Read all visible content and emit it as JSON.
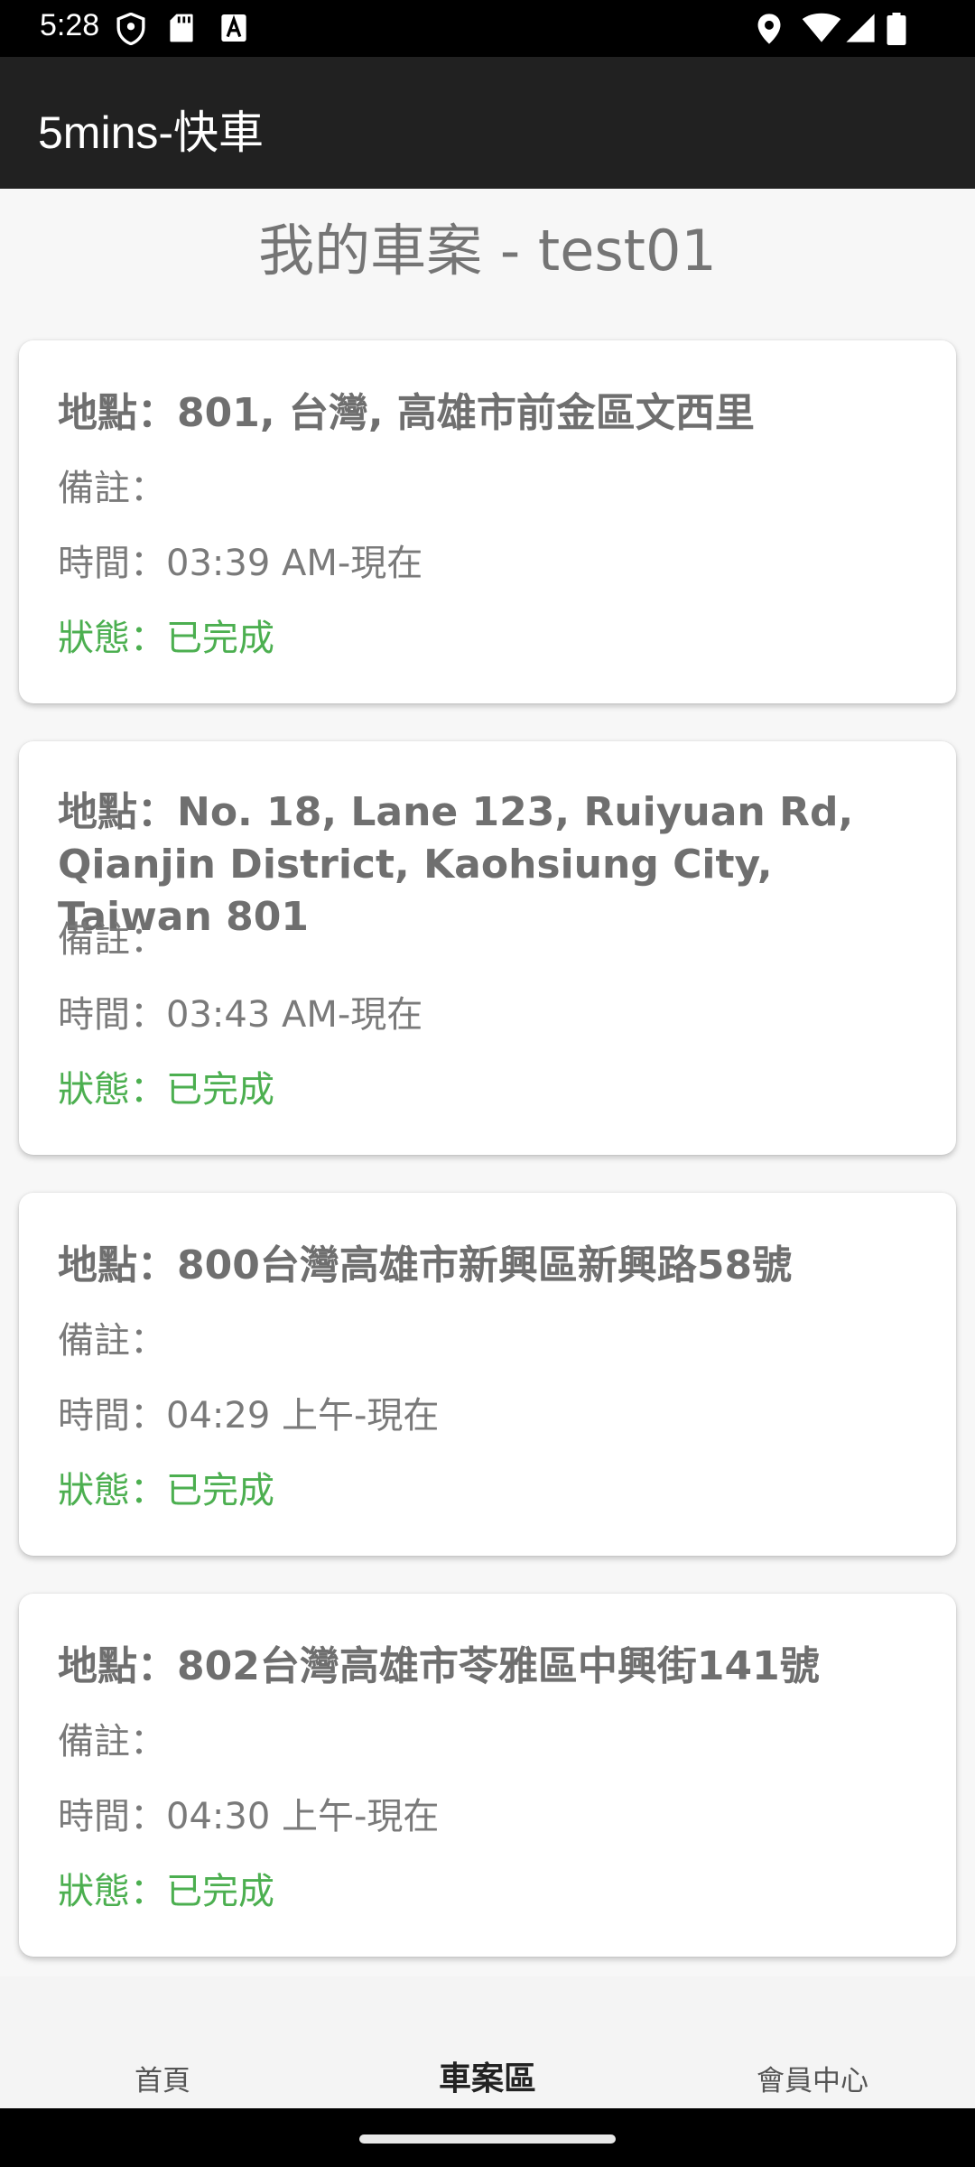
{
  "status_bar": {
    "time": "5:28",
    "icons": [
      "shield-icon",
      "sd-card-icon",
      "font-a-icon",
      "location-icon",
      "wifi-icon",
      "signal-icon",
      "battery-icon"
    ]
  },
  "app_bar": {
    "title": "5mins-快車"
  },
  "page": {
    "title": "我的車案 - test01"
  },
  "cases": [
    {
      "location": "地點：801, 台灣, 高雄市前金區文西里",
      "note": "備註：",
      "time": "時間：03:39 AM-現在",
      "status": "狀態：已完成"
    },
    {
      "location": "地點：No. 18, Lane 123, Ruiyuan Rd, Qianjin District, Kaohsiung City, Taiwan 801",
      "note": "備註：",
      "time": "時間：03:43 AM-現在",
      "status": "狀態：已完成"
    },
    {
      "location": "地點：800台灣高雄市新興區新興路58號",
      "note": "備註：",
      "time": "時間：04:29 上午-現在",
      "status": "狀態：已完成"
    },
    {
      "location": "地點：802台灣高雄市苓雅區中興街141號",
      "note": "備註：",
      "time": "時間：04:30 上午-現在",
      "status": "狀態：已完成"
    }
  ],
  "bottom_nav": {
    "items": [
      {
        "label": "首頁"
      },
      {
        "label": "車案區"
      },
      {
        "label": "會員中心"
      }
    ],
    "active": "車案區"
  },
  "colors": {
    "app_bar": "#212121",
    "status_done": "#4caf50",
    "text_gray": "#757575"
  }
}
